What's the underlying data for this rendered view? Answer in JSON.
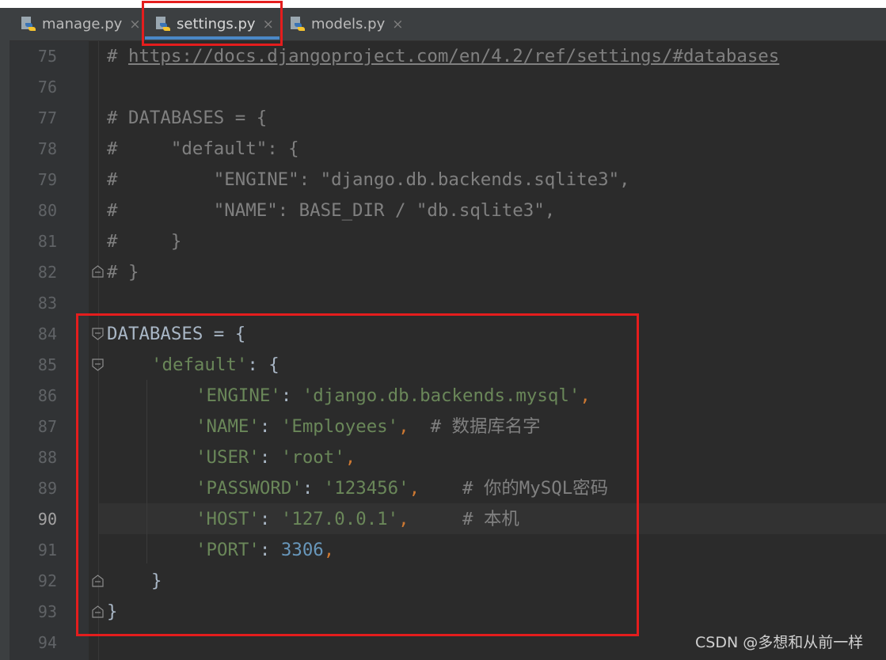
{
  "tabs": [
    {
      "label": "manage.py",
      "close": "×",
      "icon": "python-file-icon"
    },
    {
      "label": "settings.py",
      "close": "×",
      "icon": "python-file-icon"
    },
    {
      "label": "models.py",
      "close": "×",
      "icon": "python-file-icon"
    }
  ],
  "active_tab": "settings.py",
  "current_line": 90,
  "line_numbers": [
    "75",
    "76",
    "77",
    "78",
    "79",
    "80",
    "81",
    "82",
    "83",
    "84",
    "85",
    "86",
    "87",
    "88",
    "89",
    "90",
    "91",
    "92",
    "93",
    "94"
  ],
  "code": {
    "l75_hash": "# ",
    "l75_url": "https://docs.djangoproject.com/en/4.2/ref/settings/#databases",
    "l77": "# DATABASES = {",
    "l78": "#     \"default\": {",
    "l79": "#         \"ENGINE\": \"django.db.backends.sqlite3\",",
    "l80": "#         \"NAME\": BASE_DIR / \"db.sqlite3\",",
    "l81": "#     }",
    "l82": "# }",
    "l84": "DATABASES = {",
    "l85_key": "'default'",
    "l85_rest": ": {",
    "l86_key": "'ENGINE'",
    "l86_colon": ": ",
    "l86_val": "'django.db.backends.mysql'",
    "l86_comma": ",",
    "l87_key": "'NAME'",
    "l87_colon": ": ",
    "l87_val": "'Employees'",
    "l87_comma": ",",
    "l87_comment": "  # 数据库名字",
    "l88_key": "'USER'",
    "l88_colon": ": ",
    "l88_val": "'root'",
    "l88_comma": ",",
    "l89_key": "'PASSWORD'",
    "l89_colon": ": ",
    "l89_val": "'123456'",
    "l89_comma": ",",
    "l89_comment": "    # 你的MySQL密码",
    "l90_key": "'HOST'",
    "l90_colon": ": ",
    "l90_val": "'127.0.0.1'",
    "l90_comma": ",",
    "l90_comment": "     # 本机",
    "l91_key": "'PORT'",
    "l91_colon": ": ",
    "l91_val": "3306",
    "l91_comma": ",",
    "l92": "}",
    "l93": "}"
  },
  "watermark": "CSDN @多想和从前一样",
  "colors": {
    "editor_bg": "#2b2b2b",
    "gutter_bg": "#313335",
    "string": "#6a8759",
    "comment": "#808080",
    "keyword_punct": "#cc7832",
    "number": "#6897bb",
    "highlight_box": "#e41d1d",
    "tab_underline": "#4a88c7"
  }
}
